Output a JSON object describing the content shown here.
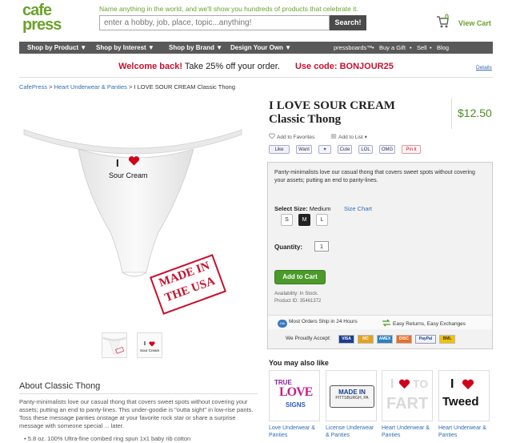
{
  "header": {
    "logo_line1": "cafe",
    "logo_line2": "press",
    "tagline": "Name anything in the world, and we'll show you hundreds of products that celebrate it.",
    "search_placeholder": "enter a hobby, job, place, topic...anything!",
    "search_button": "Search!",
    "cart_count": "0",
    "cart_label": "View Cart",
    "cart_icon": "shopping-cart-icon"
  },
  "nav": {
    "items": [
      "Shop by Product ▼",
      "Shop by Interest ▼",
      "Shop by Brand ▼",
      "Design Your Own ▼"
    ],
    "right_items": [
      "pressboards™",
      "•",
      "Buy a Gift",
      "•",
      "Sell",
      "•",
      "Blog"
    ]
  },
  "promo": {
    "welcome": "Welcome back!",
    "offer": "Take 25% off your order.",
    "code": "Use code: BONJOUR25",
    "details": "Details"
  },
  "breadcrumb": {
    "root": "CafePress",
    "separator": " > ",
    "category": "Heart Underwear & Panties",
    "current": "I LOVE SOUR CREAM Classic Thong"
  },
  "product": {
    "image_text_i": "I",
    "image_text_caption": "Sour Cream",
    "stamp_line1": "MADE IN",
    "stamp_line2": "THE USA",
    "thumb2_text_i": "I",
    "thumb2_text_caption": "Sour Cream",
    "title_line1": "I LOVE SOUR CREAM",
    "title_line2": "Classic Thong",
    "price": "$12.50",
    "add_favorites": "Add to Favorites",
    "add_list": "Add to List ▾",
    "social": [
      "Like",
      "Want",
      "♥",
      "Cute",
      "LOL",
      "OMG",
      "Pin it"
    ],
    "description": "Panty-minimalists love our casual thong that covers sweet spots without covering your assets; putting an end to panty-lines.",
    "select_size_label": "Select Size:",
    "selected_size": "Medium",
    "size_chart": "Size Chart",
    "sizes": [
      "S",
      "M",
      "L"
    ],
    "quantity_label": "Quantity:",
    "quantity_value": "1",
    "add_to_cart": "Add to Cart",
    "availability": "Availability: In Stock.",
    "product_id": "Product ID: 35461372",
    "ship_badge": "24h",
    "ship_text": "Most Orders Ship in 24 Hours",
    "returns_text": "Easy Returns, Easy Exchanges",
    "accept_label": "We Proudly Accept:",
    "cards": [
      "VISA",
      "MC",
      "AMEX",
      "DISC",
      "PayPal",
      "BML"
    ],
    "colors": {
      "accent_green": "#6aa32b",
      "price_green": "#4a8d1f",
      "promo_red": "#c8102e",
      "link_blue": "#2f6db5",
      "nav_gray": "#595959",
      "heart_red": "#d0021b"
    }
  },
  "about": {
    "title": "About Classic Thong",
    "description": "Panty-minimalists love our casual thong that covers sweet spots without covering your assets; putting an end to panty-lines. This under-goodie is \"outta sight\" in low-rise pants. Toss these message panties onstage at your favorite rock star or share a surprise message with someone special ... later.",
    "bullet": "•  5.8 oz. 100% Ultra-fine combed ring spun 1x1 baby rib cotton"
  },
  "also_like": {
    "title": "You may also like",
    "items": [
      {
        "label": "Love Underwear & Panties",
        "art_line1": "TRUE",
        "art_line2": "LOVE",
        "art_line3": "SIGNS"
      },
      {
        "label": "License Underwear & Panties",
        "art_line1": "MADE IN",
        "art_line2": "PITTSBURGH, PA"
      },
      {
        "label": "Heart Underwear & Panties",
        "art_line1": "I",
        "art_line2": "TO",
        "art_line3": "FART"
      },
      {
        "label": "Heart Underwear & Panties",
        "art_line1": "I",
        "art_line2": "Tweed"
      }
    ]
  }
}
